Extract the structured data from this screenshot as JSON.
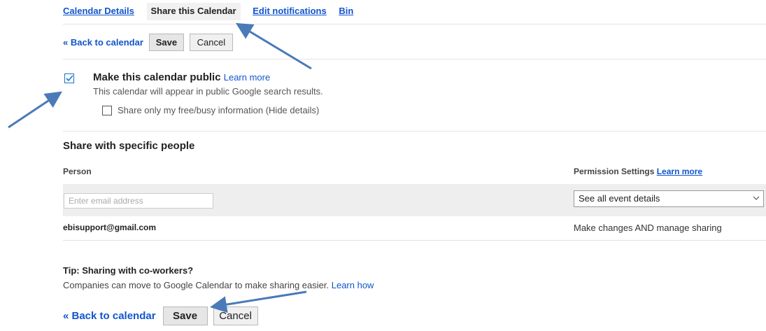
{
  "tabs": [
    {
      "label": "Calendar Details"
    },
    {
      "label": "Share this Calendar"
    },
    {
      "label": "Edit notifications"
    },
    {
      "label": "Bin"
    }
  ],
  "toolbar_top": {
    "back": "« Back to calendar",
    "save": "Save",
    "cancel": "Cancel"
  },
  "public": {
    "label": "Make this calendar public",
    "learn_more": "Learn more",
    "description": "This calendar will appear in public Google search results.",
    "checked": true,
    "free_busy_label": "Share only my free/busy information (Hide details)",
    "free_busy_checked": false
  },
  "share": {
    "title": "Share with specific people",
    "person_header": "Person",
    "permission_header": "Permission Settings",
    "permission_learn_more": "Learn more",
    "email_placeholder": "Enter email address",
    "permission_selected": "See all event details",
    "rows": [
      {
        "email": "ebisupport@gmail.com",
        "permission": "Make changes AND manage sharing"
      }
    ]
  },
  "tip": {
    "title": "Tip: Sharing with co-workers?",
    "text": "Companies can move to Google Calendar to make sharing easier.",
    "link": "Learn how"
  },
  "toolbar_bottom": {
    "back": "« Back to calendar",
    "save": "Save",
    "cancel": "Cancel"
  },
  "colors": {
    "link": "#1155cc",
    "annotation_arrow": "#4a7ab8",
    "checkbox_checked": "#1a73c8"
  }
}
